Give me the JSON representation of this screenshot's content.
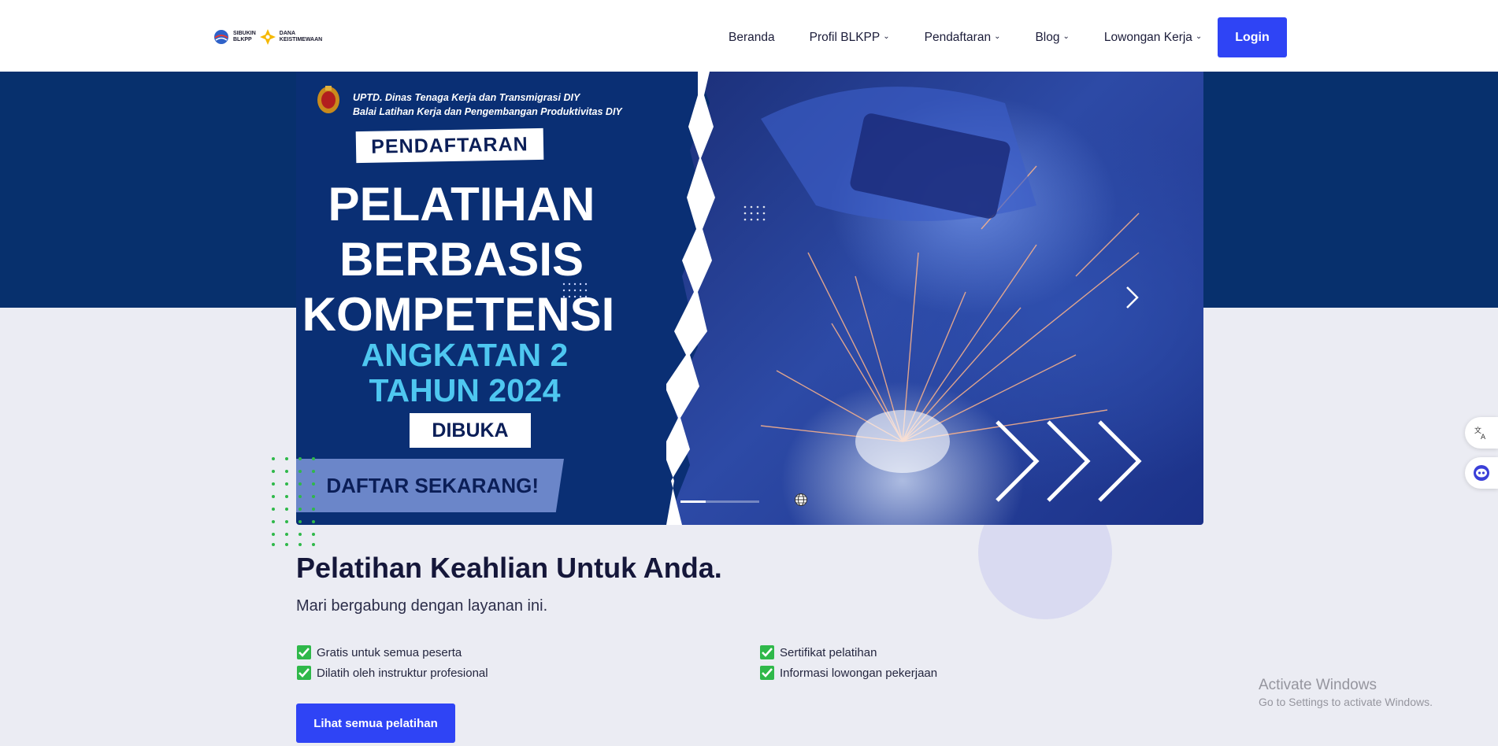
{
  "header": {
    "logo": {
      "brand1_line1": "SIBUKIN",
      "brand1_line2": "BLKPP",
      "brand2_line1": "DANA",
      "brand2_line2": "KEISTIMEWAAN"
    },
    "nav": [
      {
        "label": "Beranda",
        "dropdown": false
      },
      {
        "label": "Profil BLKPP",
        "dropdown": true
      },
      {
        "label": "Pendaftaran",
        "dropdown": true
      },
      {
        "label": "Blog",
        "dropdown": true
      },
      {
        "label": "Lowongan Kerja",
        "dropdown": true
      }
    ],
    "login_label": "Login"
  },
  "banner": {
    "org_line1": "UPTD. Dinas Tenaga Kerja dan Transmigrasi DIY",
    "org_line2": "Balai Latihan Kerja dan Pengembangan Produktivitas DIY",
    "tag": "PENDAFTARAN",
    "title_line1": "PELATIHAN",
    "title_line2": "BERBASIS",
    "title_line3": "KOMPETENSI",
    "sub_line1": "ANGKATAN 2",
    "sub_line2": "TAHUN 2024",
    "status": "DIBUKA",
    "cta": "DAFTAR SEKARANG!",
    "next_icon": "chevron-right-icon"
  },
  "content": {
    "title": "Pelatihan Keahlian Untuk Anda.",
    "subtitle": "Mari bergabung dengan layanan ini.",
    "features_left": [
      "Gratis untuk semua peserta",
      "Dilatih oleh instruktur profesional"
    ],
    "features_right": [
      "Sertifikat pelatihan",
      "Informasi lowongan pekerjaan"
    ],
    "cta_label": "Lihat semua pelatihan"
  },
  "watermark": {
    "line1": "Activate Windows",
    "line2": "Go to Settings to activate Windows."
  },
  "colors": {
    "primary": "#2f44f5",
    "band": "#07306d",
    "background": "#ebecf3",
    "check": "#2fb84a"
  }
}
